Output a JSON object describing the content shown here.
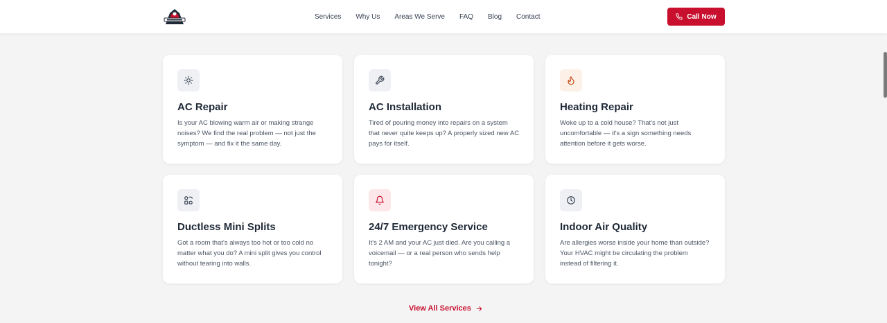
{
  "header": {
    "nav": [
      "Services",
      "Why Us",
      "Areas We Serve",
      "FAQ",
      "Blog",
      "Contact"
    ],
    "cta_label": "Call Now",
    "brand_color": "#c8102e"
  },
  "services": [
    {
      "title": "AC Repair",
      "icon": "sun-icon",
      "description": "Is your AC blowing warm air or making strange noises? We find the real problem — not just the symptom — and fix it the same day."
    },
    {
      "title": "AC Installation",
      "icon": "wrench-icon",
      "description": "Tired of pouring money into repairs on a system that never quite keeps up? A properly sized new AC pays for itself."
    },
    {
      "title": "Heating Repair",
      "icon": "flame-icon",
      "description": "Woke up to a cold house? That's not just uncomfortable — it's a sign something needs attention before it gets worse."
    },
    {
      "title": "Ductless Mini Splits",
      "icon": "grid-icon",
      "description": "Got a room that's always too hot or too cold no matter what you do? A mini split gives you control without tearing into walls."
    },
    {
      "title": "24/7 Emergency Service",
      "icon": "bell-icon",
      "description": "It's 2 AM and your AC just died. Are you calling a voicemail — or a real person who sends help tonight?"
    },
    {
      "title": "Indoor Air Quality",
      "icon": "clock-icon",
      "description": "Are allergies worse inside your home than outside? Your HVAC might be circulating the problem instead of filtering it."
    }
  ],
  "view_all_label": "View All Services"
}
